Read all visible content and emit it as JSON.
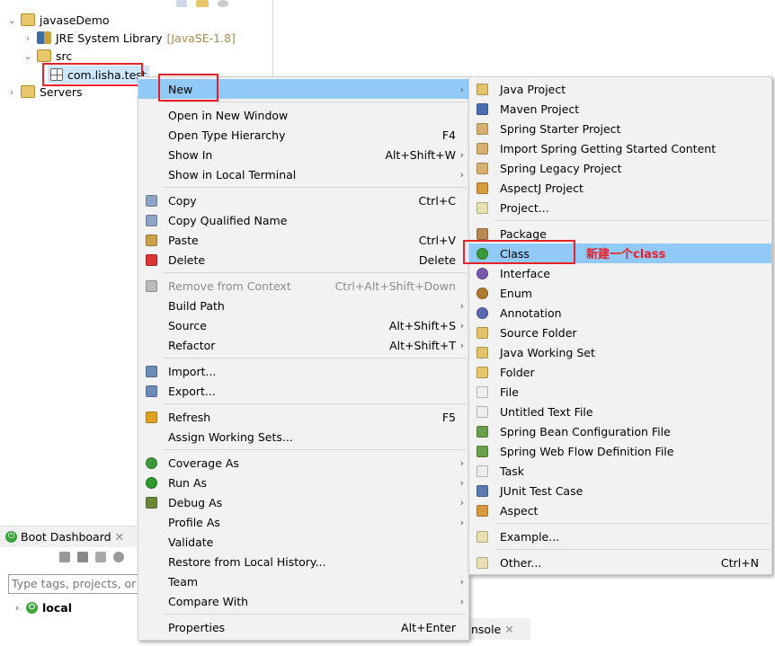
{
  "explorer": {
    "project": "javaseDemo",
    "jre": "JRE System Library",
    "jre_decor": "[JavaSE-1.8]",
    "src": "src",
    "package": "com.lisha.test",
    "servers": "Servers"
  },
  "dashboard": {
    "tab_label": "Boot Dashboard",
    "search_placeholder": "Type tags, projects, or working set names to match",
    "local": "local"
  },
  "console_tab": "nsole",
  "context_menu": {
    "items": [
      {
        "label": "New",
        "arrow": true,
        "highlight": true
      },
      {
        "sep": true
      },
      {
        "label": "Open in New Window"
      },
      {
        "label": "Open Type Hierarchy",
        "shortcut": "F4"
      },
      {
        "label": "Show In",
        "shortcut": "Alt+Shift+W",
        "arrow": true
      },
      {
        "label": "Show in Local Terminal",
        "arrow": true
      },
      {
        "sep": true
      },
      {
        "label": "Copy",
        "shortcut": "Ctrl+C",
        "icon": "copy-icon"
      },
      {
        "label": "Copy Qualified Name",
        "icon": "copy-qualified-icon"
      },
      {
        "label": "Paste",
        "shortcut": "Ctrl+V",
        "icon": "paste-icon"
      },
      {
        "label": "Delete",
        "shortcut": "Delete",
        "icon": "delete-icon"
      },
      {
        "sep": true
      },
      {
        "label": "Remove from Context",
        "shortcut": "Ctrl+Alt+Shift+Down",
        "disabled": true,
        "icon": "remove-context-icon"
      },
      {
        "label": "Build Path",
        "arrow": true
      },
      {
        "label": "Source",
        "shortcut": "Alt+Shift+S",
        "arrow": true
      },
      {
        "label": "Refactor",
        "shortcut": "Alt+Shift+T",
        "arrow": true
      },
      {
        "sep": true
      },
      {
        "label": "Import...",
        "icon": "import-icon"
      },
      {
        "label": "Export...",
        "icon": "export-icon"
      },
      {
        "sep": true
      },
      {
        "label": "Refresh",
        "shortcut": "F5",
        "icon": "refresh-icon"
      },
      {
        "label": "Assign Working Sets..."
      },
      {
        "sep": true
      },
      {
        "label": "Coverage As",
        "arrow": true,
        "icon": "coverage-icon"
      },
      {
        "label": "Run As",
        "arrow": true,
        "icon": "run-icon"
      },
      {
        "label": "Debug As",
        "arrow": true,
        "icon": "debug-icon"
      },
      {
        "label": "Profile As",
        "arrow": true
      },
      {
        "label": "Validate"
      },
      {
        "label": "Restore from Local History..."
      },
      {
        "label": "Team",
        "arrow": true
      },
      {
        "label": "Compare With",
        "arrow": true
      },
      {
        "sep": true
      },
      {
        "label": "Properties",
        "shortcut": "Alt+Enter"
      }
    ]
  },
  "new_submenu": {
    "items": [
      {
        "label": "Java Project",
        "icon": "java-project-icon"
      },
      {
        "label": "Maven Project",
        "icon": "maven-project-icon"
      },
      {
        "label": "Spring Starter Project",
        "icon": "spring-project-icon"
      },
      {
        "label": "Import Spring Getting Started Content",
        "icon": "spring-project-icon"
      },
      {
        "label": "Spring Legacy Project",
        "icon": "spring-project-icon"
      },
      {
        "label": "AspectJ Project",
        "icon": "aspectj-project-icon"
      },
      {
        "label": "Project...",
        "icon": "project-icon"
      },
      {
        "sep": true
      },
      {
        "label": "Package",
        "icon": "package-icon"
      },
      {
        "label": "Class",
        "icon": "class-icon",
        "highlight": true
      },
      {
        "label": "Interface",
        "icon": "interface-icon"
      },
      {
        "label": "Enum",
        "icon": "enum-icon"
      },
      {
        "label": "Annotation",
        "icon": "annotation-icon"
      },
      {
        "label": "Source Folder",
        "icon": "source-folder-icon"
      },
      {
        "label": "Java Working Set",
        "icon": "working-set-icon"
      },
      {
        "label": "Folder",
        "icon": "folder-icon"
      },
      {
        "label": "File",
        "icon": "file-icon"
      },
      {
        "label": "Untitled Text File",
        "icon": "text-file-icon"
      },
      {
        "label": "Spring Bean Configuration File",
        "icon": "spring-file-icon"
      },
      {
        "label": "Spring Web Flow Definition File",
        "icon": "spring-file-icon"
      },
      {
        "label": "Task",
        "icon": "task-icon"
      },
      {
        "label": "JUnit Test Case",
        "icon": "junit-icon"
      },
      {
        "label": "Aspect",
        "icon": "aspect-icon"
      },
      {
        "sep": true
      },
      {
        "label": "Example...",
        "icon": "example-icon"
      },
      {
        "sep": true
      },
      {
        "label": "Other...",
        "shortcut": "Ctrl+N",
        "icon": "other-icon"
      }
    ]
  },
  "annotation_note": "新建一个class",
  "colors": {
    "highlight": "#91c9f7",
    "annotation_red": "#e8202a",
    "menu_bg": "#f2f2f2"
  }
}
